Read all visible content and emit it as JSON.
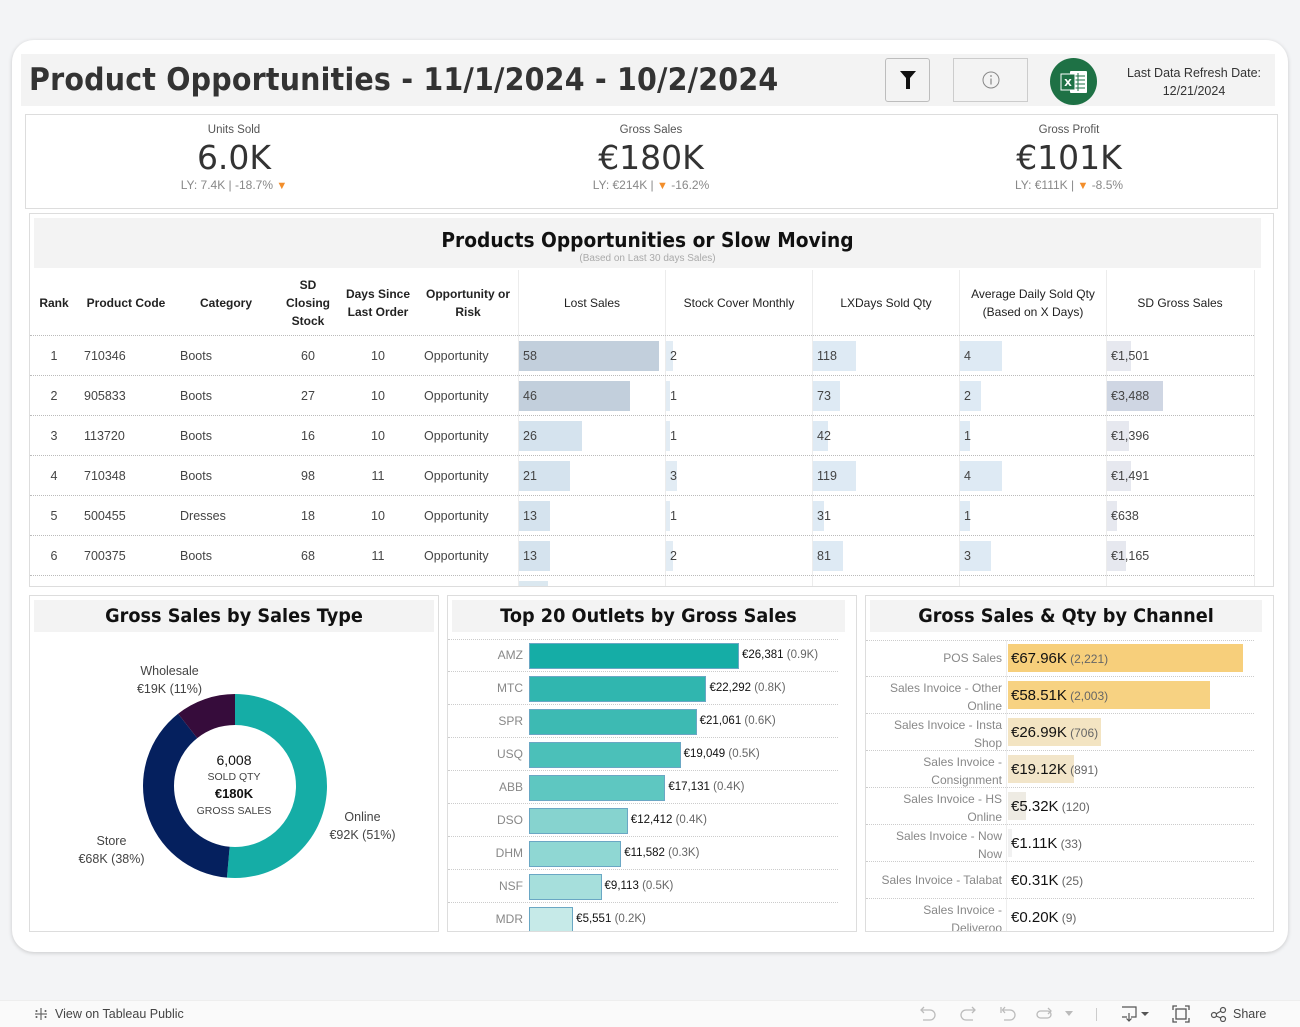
{
  "header": {
    "title": "Product Opportunities - 11/1/2024 - 10/2/2024",
    "refresh_label": "Last Data Refresh Date:",
    "refresh_date": "12/21/2024",
    "filter_icon": "filter-icon",
    "info_icon": "info-icon",
    "excel_icon": "excel-icon"
  },
  "kpis": [
    {
      "label": "Units Sold",
      "value": "6.0K",
      "ly": "LY: 7.4K | -18.7%",
      "trend": "down"
    },
    {
      "label": "Gross Sales",
      "value": "€180K",
      "ly_prefix": "LY: €214K  |",
      "ly_change": "-16.2%",
      "trend": "down"
    },
    {
      "label": "Gross Profit",
      "value": "€101K",
      "ly_prefix": "LY: €111K |",
      "ly_change": "-8.5%",
      "trend": "down"
    }
  ],
  "table": {
    "title": "Products Opportunities or Slow Moving",
    "subtitle": "(Based on Last 30 days Sales)",
    "columns": [
      "Rank",
      "Product Code",
      "Category",
      "SD Closing Stock",
      "Days Since Last Order",
      "Opportunity or Risk",
      "Lost Sales",
      "Stock Cover Monthly",
      "LXDays Sold Qty",
      "Average Daily Sold Qty (Based on X Days)",
      "SD Gross Sales"
    ],
    "column_lines": {
      "sd_closing": [
        "SD",
        "Closing",
        "Stock"
      ],
      "days_since": [
        "Days Since",
        "Last Order"
      ],
      "opp_risk": [
        "Opportunity or",
        "Risk"
      ],
      "avg_daily": [
        "Average Daily Sold Qty",
        "(Based on X Days)"
      ]
    },
    "rows": [
      {
        "rank": "1",
        "code": "710346",
        "category": "Boots",
        "stock": "60",
        "days": "10",
        "type": "Opportunity",
        "lost_sales": 58,
        "stock_cover": 2,
        "lx_qty": 118,
        "avg_daily": 4,
        "gross": "€1,501",
        "gross_value": 1501
      },
      {
        "rank": "2",
        "code": "905833",
        "category": "Boots",
        "stock": "27",
        "days": "10",
        "type": "Opportunity",
        "lost_sales": 46,
        "stock_cover": 1,
        "lx_qty": 73,
        "avg_daily": 2,
        "gross": "€3,488",
        "gross_value": 3488
      },
      {
        "rank": "3",
        "code": "113720",
        "category": "Boots",
        "stock": "16",
        "days": "10",
        "type": "Opportunity",
        "lost_sales": 26,
        "stock_cover": 1,
        "lx_qty": 42,
        "avg_daily": 1,
        "gross": "€1,396",
        "gross_value": 1396
      },
      {
        "rank": "4",
        "code": "710348",
        "category": "Boots",
        "stock": "98",
        "days": "11",
        "type": "Opportunity",
        "lost_sales": 21,
        "stock_cover": 3,
        "lx_qty": 119,
        "avg_daily": 4,
        "gross": "€1,491",
        "gross_value": 1491
      },
      {
        "rank": "5",
        "code": "500455",
        "category": "Dresses",
        "stock": "18",
        "days": "10",
        "type": "Opportunity",
        "lost_sales": 13,
        "stock_cover": 1,
        "lx_qty": 31,
        "avg_daily": 1,
        "gross": "€638",
        "gross_value": 638
      },
      {
        "rank": "6",
        "code": "700375",
        "category": "Boots",
        "stock": "68",
        "days": "11",
        "type": "Opportunity",
        "lost_sales": 13,
        "stock_cover": 2,
        "lx_qty": 81,
        "avg_daily": 3,
        "gross": "€1,165",
        "gross_value": 1165
      }
    ]
  },
  "donut": {
    "title": "Gross Sales by Sales Type",
    "center_qty": "6,008",
    "center_qty_label": "SOLD QTY",
    "center_sales": "€180K",
    "center_sales_label": "GROSS SALES"
  },
  "outlets": {
    "title": "Top 20 Outlets by Gross Sales"
  },
  "channels": {
    "title": "Gross Sales & Qty by Channel"
  },
  "chart_data": [
    {
      "type": "pie",
      "title": "Gross Sales by Sales Type",
      "categories": [
        "Online",
        "Store",
        "Wholesale"
      ],
      "values": [
        92,
        68,
        19
      ],
      "value_labels": [
        "€92K",
        "€68K",
        "€19K"
      ],
      "percents": [
        "51%",
        "38%",
        "11%"
      ],
      "colors": [
        "#15ada6",
        "#05205e",
        "#360c3b"
      ]
    },
    {
      "type": "bar",
      "orientation": "horizontal",
      "title": "Top 20 Outlets by Gross Sales",
      "categories": [
        "AMZ",
        "MTC",
        "SPR",
        "USQ",
        "ABB",
        "DSO",
        "DHM",
        "NSF",
        "MDR"
      ],
      "values": [
        26381,
        22292,
        21061,
        19049,
        17131,
        12412,
        11582,
        9113,
        5551
      ],
      "value_labels": [
        "€26,381",
        "€22,292",
        "€21,061",
        "€19,049",
        "€17,131",
        "€12,412",
        "€11,582",
        "€9,113",
        "€5,551"
      ],
      "qty_labels": [
        "(0.9K)",
        "(0.8K)",
        "(0.6K)",
        "(0.5K)",
        "(0.4K)",
        "(0.4K)",
        "(0.3K)",
        "(0.5K)",
        "(0.2K)"
      ],
      "xlim": [
        0,
        26381
      ]
    },
    {
      "type": "bar",
      "orientation": "horizontal",
      "title": "Gross Sales & Qty by Channel",
      "categories": [
        "POS Sales",
        "Sales Invoice - Other Online",
        "Sales Invoice - Insta Shop",
        "Sales Invoice - Consignment",
        "Sales Invoice - HS Online",
        "Sales Invoice - Now Now",
        "Sales Invoice - Talabat",
        "Sales Invoice - Deliveroo"
      ],
      "category_lines": [
        [
          "POS Sales"
        ],
        [
          "Sales Invoice - Other",
          "Online"
        ],
        [
          "Sales Invoice - Insta",
          "Shop"
        ],
        [
          "Sales Invoice -",
          "Consignment"
        ],
        [
          "Sales Invoice - HS",
          "Online"
        ],
        [
          "Sales Invoice - Now",
          "Now"
        ],
        [
          "Sales Invoice - Talabat"
        ],
        [
          "Sales Invoice -",
          "Deliveroo"
        ]
      ],
      "values": [
        67.96,
        58.51,
        26.99,
        19.12,
        5.32,
        1.11,
        0.31,
        0.2
      ],
      "value_labels": [
        "€67.96K",
        "€58.51K",
        "€26.99K",
        "€19.12K",
        "€5.32K",
        "€1.11K",
        "€0.31K",
        "€0.20K"
      ],
      "qty": [
        2221,
        2003,
        706,
        891,
        120,
        33,
        25,
        9
      ],
      "qty_labels": [
        "(2,221)",
        "(2,003)",
        "(706)",
        "(891)",
        "(120)",
        "(33)",
        "(25)",
        "(9)"
      ],
      "xlim": [
        0,
        70
      ]
    }
  ],
  "footer": {
    "view_label": "View on Tableau Public",
    "share_label": "Share"
  }
}
